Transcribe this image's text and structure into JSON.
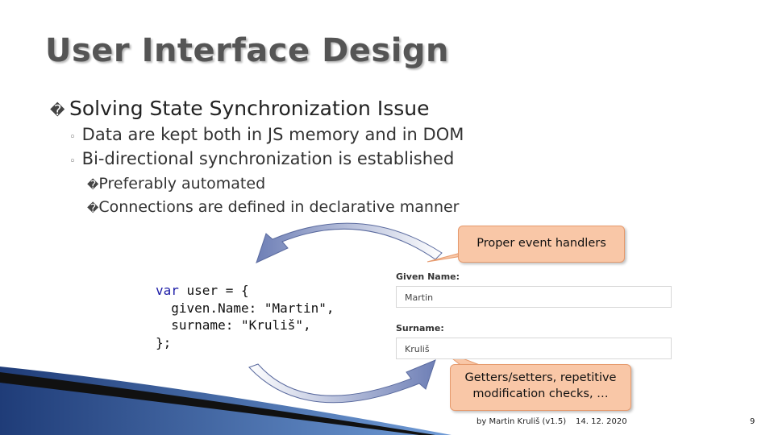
{
  "slide": {
    "title": "User Interface Design",
    "bullets": {
      "l1_marker": "�",
      "l1_text": "Solving State Synchronization Issue",
      "l2_marker": "◦",
      "l2": [
        "Data are kept both in JS memory and in DOM",
        "Bi-directional synchronization is established"
      ],
      "l3_marker": "�",
      "l3": [
        "Preferably automated",
        "Connections are defined in declarative manner"
      ]
    },
    "code": {
      "kw_var": "var",
      "line1_rest": " user = {",
      "line2": "  given.Name: \"Martin\",",
      "line3": "  surname: \"Kruliš\",",
      "line4": "};"
    },
    "form": {
      "given_label": "Given Name:",
      "given_value": "Martin",
      "surname_label": "Surname:",
      "surname_value": "Kruliš"
    },
    "callouts": {
      "top": "Proper event handlers",
      "bottom": "Getters/setters, repetitive modification checks, …"
    },
    "footer": {
      "author": "by Martin Kruliš (v1.5)",
      "date": "14. 12. 2020",
      "page": "9"
    },
    "colors": {
      "callout_fill": "#f9c7a7",
      "callout_border": "#e69a6d",
      "arrow_light": "#ffffff",
      "arrow_dark": "#6e7fb6",
      "code_keyword": "#1a1aa6"
    }
  }
}
